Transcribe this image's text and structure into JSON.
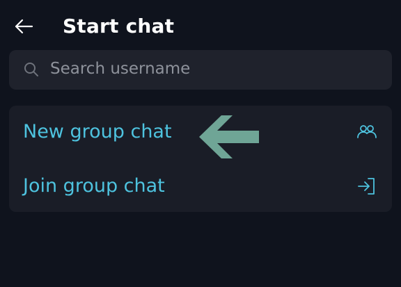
{
  "header": {
    "title": "Start chat"
  },
  "search": {
    "placeholder": "Search username",
    "value": ""
  },
  "options": [
    {
      "label": "New group chat",
      "icon": "group-icon"
    },
    {
      "label": "Join group chat",
      "icon": "join-icon"
    }
  ],
  "colors": {
    "background": "#0f131d",
    "surface": "#1f222c",
    "card": "#1a1d27",
    "accent": "#4ec3df",
    "annotation_arrow": "#6fa596",
    "placeholder": "#8e929b"
  }
}
